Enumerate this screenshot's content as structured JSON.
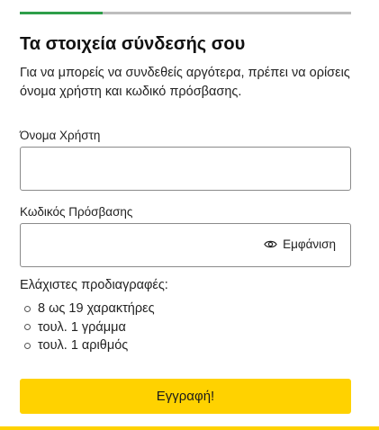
{
  "progress": {
    "fraction": 0.25,
    "fill_color": "#2e9e4a",
    "track_color": "#bdbdbd"
  },
  "title": "Τα στοιχεία σύνδεσής σου",
  "subtitle": "Για να μπορείς να συνδεθείς αργότερα, πρέπει να ορίσεις όνομα χρήστη και κωδικό πρόσβασης.",
  "username": {
    "label": "Όνομα Χρήστη",
    "value": ""
  },
  "password": {
    "label": "Κωδικός Πρόσβασης",
    "value": "",
    "show_label": "Εμφάνιση",
    "show_icon": "eye-icon"
  },
  "requirements": {
    "title": "Ελάχιστες προδιαγραφές:",
    "items": [
      "8 ως 19 χαρακτήρες",
      "τουλ. 1 γράμμα",
      "τουλ. 1 αριθμός"
    ]
  },
  "submit": {
    "label": "Εγγραφή!",
    "color": "#ffd200"
  }
}
